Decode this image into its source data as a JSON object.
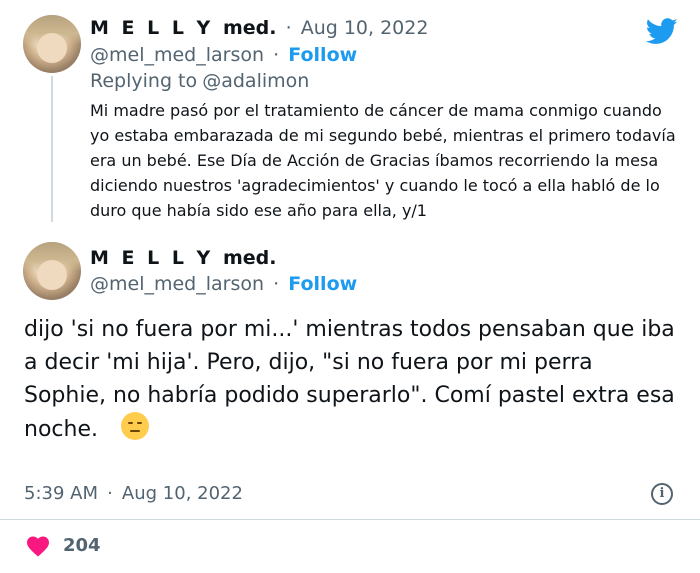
{
  "tweet1": {
    "display_name": "M E L L Y",
    "display_suffix": "med.",
    "dot": "·",
    "date": "Aug 10, 2022",
    "handle": "@mel_med_larson",
    "handle_dot": "·",
    "follow_label": "Follow",
    "replying_prefix": "Replying to",
    "replying_to": "@adalimon",
    "text": "Mi madre pasó por el tratamiento de cáncer de mama conmigo cuando yo estaba embarazada de mi segundo bebé, mientras el primero todavía era un bebé. Ese Día de Acción de Gracias íbamos recorriendo la mesa diciendo nuestros 'agradecimientos' y cuando le tocó a ella habló de lo duro que había sido ese año para ella, y/1"
  },
  "tweet2": {
    "display_name": "M E L L Y",
    "display_suffix": "med.",
    "handle": "@mel_med_larson",
    "handle_dot": "·",
    "follow_label": "Follow",
    "text": "dijo 'si no fuera por mi...'  mientras todos pensaban que iba a decir 'mi hija'. Pero, dijo, \"si no fuera por mi perra Sophie, no habría podido superarlo\". Comí pastel extra esa noche.",
    "emoji": "expressionless-face",
    "time": "5:39 AM",
    "time_dot": "·",
    "date": "Aug 10, 2022",
    "info_glyph": "i"
  },
  "likes": {
    "count": "204"
  },
  "icons": {
    "brand": "twitter-bird",
    "like": "heart",
    "info": "info-circle"
  },
  "colors": {
    "accent": "#1d9bf0",
    "heart": "#f91880",
    "muted": "#536471"
  }
}
